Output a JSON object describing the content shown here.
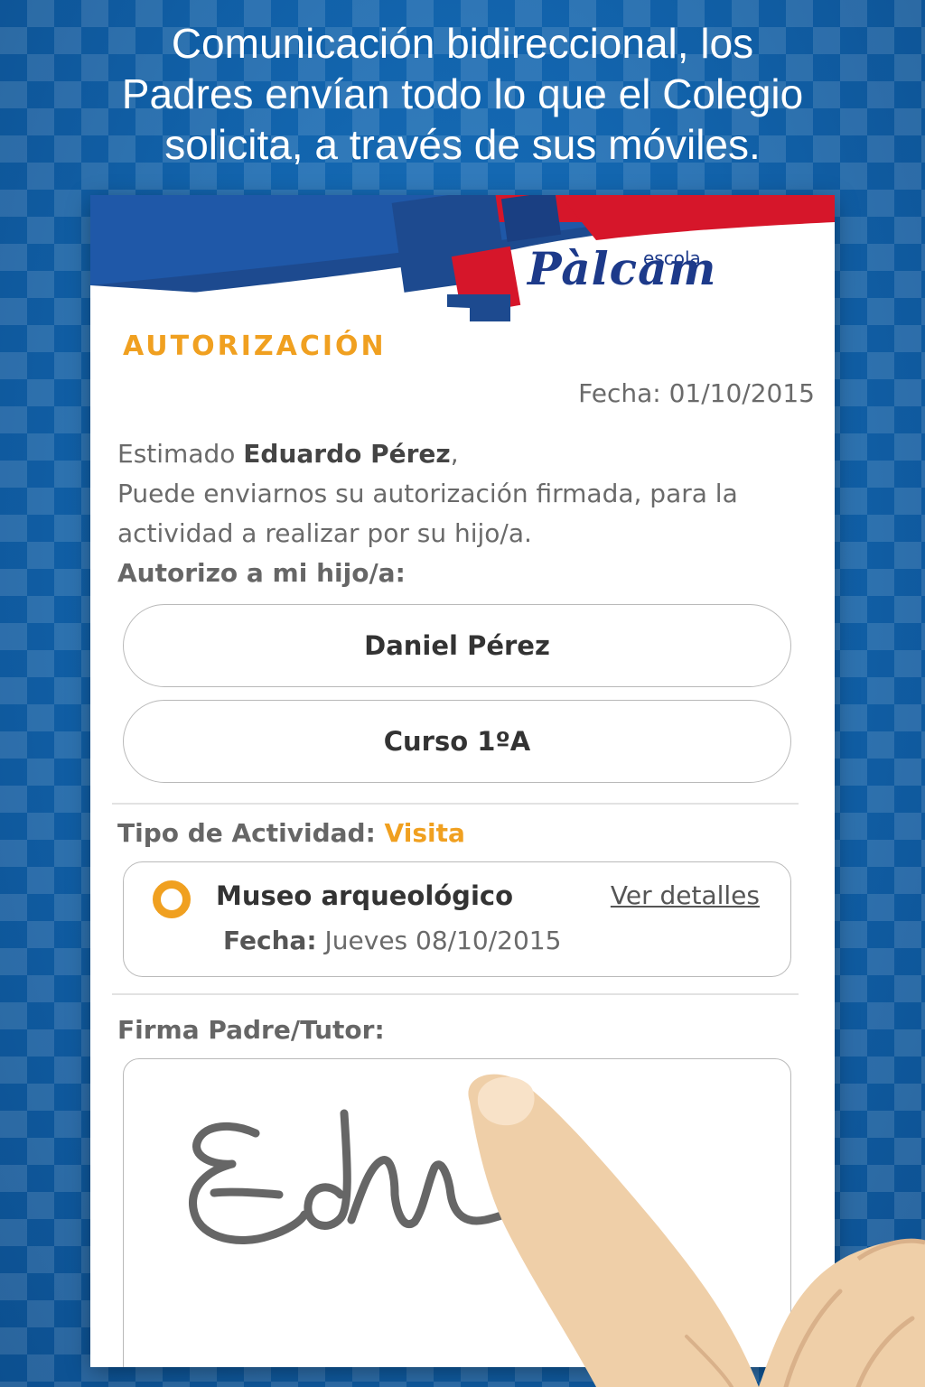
{
  "headline": {
    "line1": "Comunicación bidireccional, los",
    "line2": "Padres envían todo lo que el Colegio",
    "line3": "solicita, a través de sus móviles."
  },
  "brand": {
    "escola": "escola",
    "name": "Pàlcam",
    "colors": {
      "blue": "#1d3a8a",
      "red": "#d6162a",
      "orange": "#f0a020"
    }
  },
  "form": {
    "title": "AUTORIZACIÓN",
    "date_label": "Fecha:",
    "date_value": "01/10/2015",
    "greeting_prefix": "Estimado",
    "parent_name": "Eduardo Pérez",
    "greeting_suffix": ",",
    "message": "Puede enviarnos su autorización firmada, para la actividad a realizar por su hijo/a.",
    "authorize_label": "Autorizo a mi hijo/a:",
    "child_name": "Daniel Pérez",
    "course": "Curso 1ºA",
    "activity_type_label": "Tipo de Actividad:",
    "activity_type_value": "Visita",
    "activity": {
      "name": "Museo arqueológico",
      "details_link": "Ver detalles",
      "date_label": "Fecha:",
      "date_value": "Jueves 08/10/2015",
      "selected": true
    },
    "signature_label": "Firma Padre/Tutor:"
  },
  "icons": [
    "radio-selected-icon",
    "finger-hand-icon",
    "signature-stroke"
  ]
}
